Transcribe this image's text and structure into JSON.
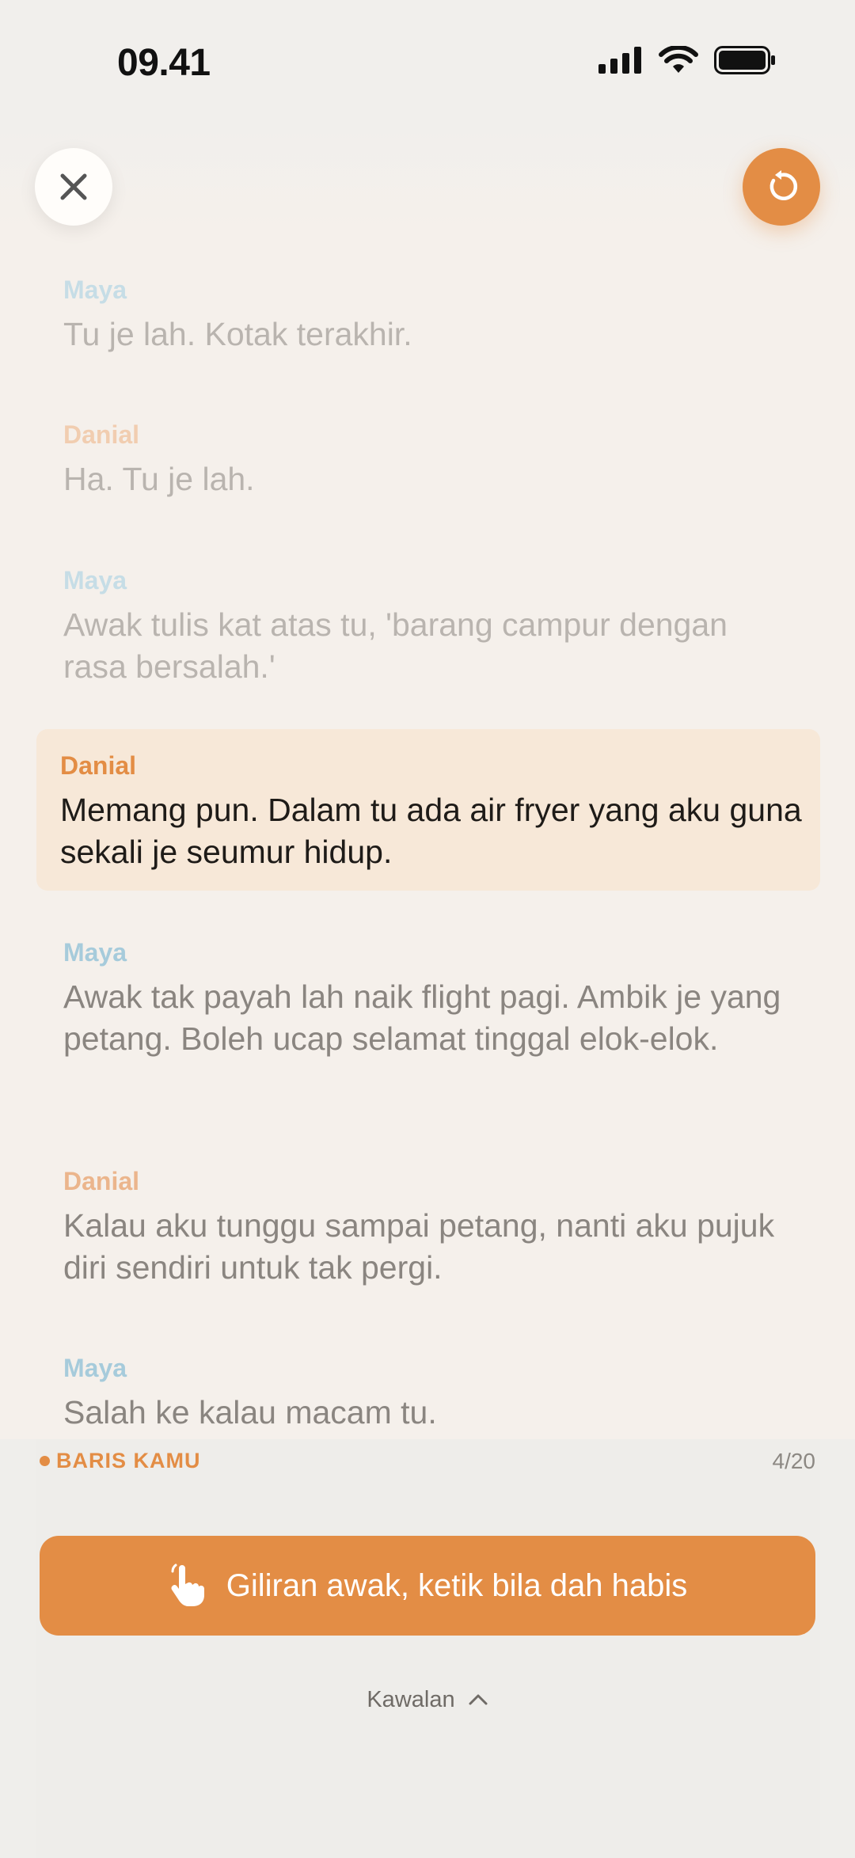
{
  "status_bar": {
    "time": "09.41"
  },
  "header": {
    "close_icon": "close-icon",
    "restart_icon": "restart-icon"
  },
  "script_lines": [
    {
      "speaker": "Maya",
      "text": "Tu je lah. Kotak terakhir."
    },
    {
      "speaker": "Danial",
      "text": "Ha. Tu je lah."
    },
    {
      "speaker": "Maya",
      "text": "Awak tulis kat atas tu, 'barang campur dengan rasa bersalah.'"
    },
    {
      "speaker": "Danial",
      "text": "Memang pun. Dalam tu ada air fryer yang aku guna sekali je seumur hidup."
    },
    {
      "speaker": "Maya",
      "text": "Awak tak payah lah naik flight pagi. Ambik je yang petang. Boleh ucap selamat tinggal elok-elok."
    },
    {
      "speaker": "Danial",
      "text": "Kalau aku tunggu sampai petang, nanti aku pujuk diri sendiri untuk tak pergi."
    },
    {
      "speaker": "Maya",
      "text": "Salah ke kalau macam tu."
    }
  ],
  "bottom": {
    "your_line_label": "BARIS KAMU",
    "counter": "4/20",
    "cta_label": "Giliran awak, ketik bila dah habis",
    "cta_icon": "tap-hand-icon",
    "prompt_toggle": "Kawalan",
    "toggle_icon": "chevron-up-icon"
  },
  "colors": {
    "accent": "#e38d45",
    "maya": "#a6cbdb",
    "danial": "#ebb58c",
    "active_bg": "#f7e8d8"
  }
}
